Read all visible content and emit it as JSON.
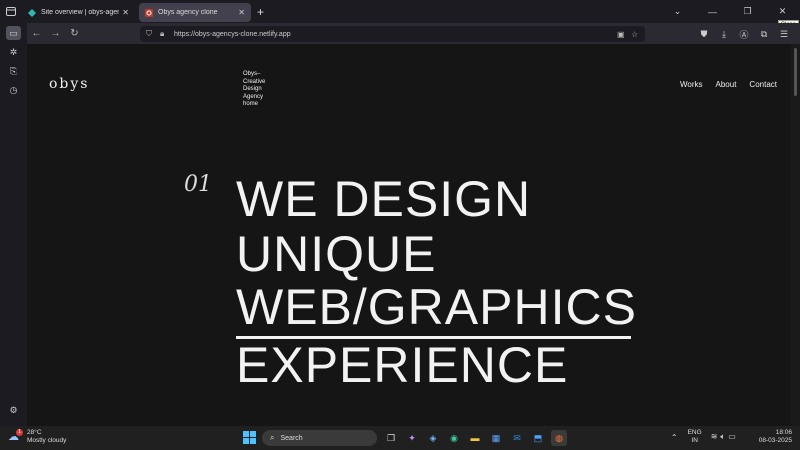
{
  "browser": {
    "tabs": [
      {
        "title": "Site overview | obys-agencys-cl",
        "active": false
      },
      {
        "title": "Obys agency clone",
        "active": true
      }
    ],
    "new_tab": "+",
    "window_controls": {
      "list": "⌄",
      "minimize": "—",
      "restore": "❐",
      "close": "✕"
    },
    "close_tooltip": "Close",
    "url": "https://obys-agencys-clone.netlify.app"
  },
  "site": {
    "logo": "obys",
    "tagline_lines": [
      "Obys–",
      "Creative",
      "Design",
      "Agency",
      "home"
    ],
    "nav": [
      "Works",
      "About",
      "Contact"
    ],
    "hero_number": "01",
    "hero_lines": [
      "WE DESIGN",
      "UNIQUE",
      "WEB/GRAPHICS",
      "EXPERIENCE"
    ]
  },
  "taskbar": {
    "weather_temp": "28°C",
    "weather_desc": "Mostly cloudy",
    "weather_badge": "1",
    "search_placeholder": "Search",
    "lang_top": "ENG",
    "lang_bottom": "IN",
    "time": "18:06",
    "date": "08-03-2025"
  },
  "colors": {
    "page_bg": "#151515",
    "text": "#f2f2f2",
    "tab_active_bg": "#42414d",
    "accent_start": "#4cc2ff"
  }
}
